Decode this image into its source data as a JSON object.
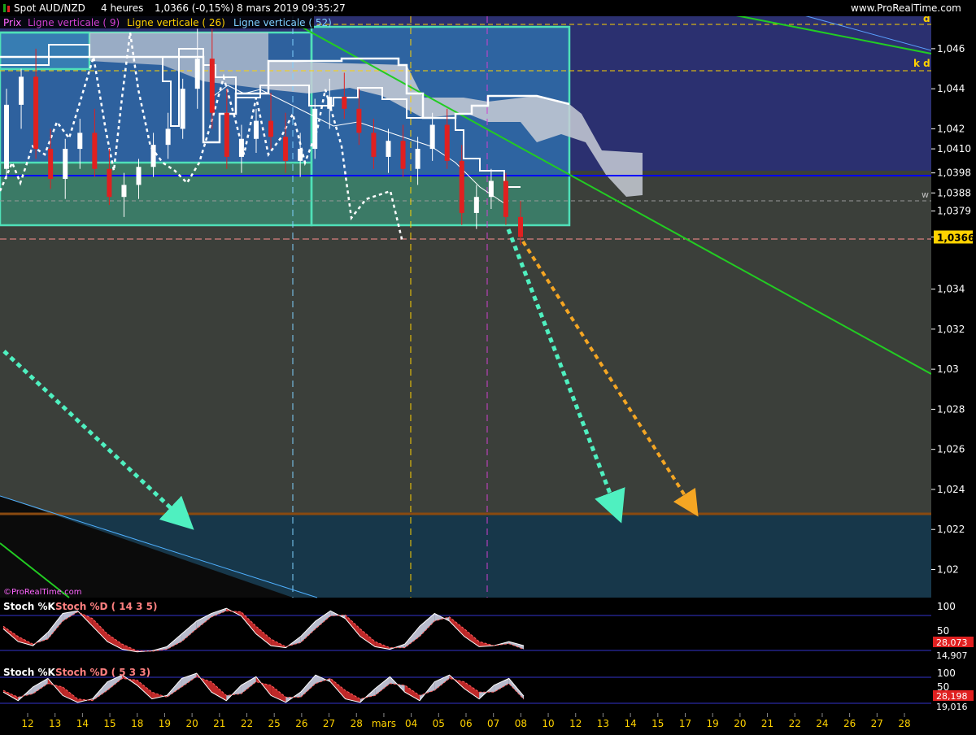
{
  "header": {
    "instrument": "Spot AUD/NZD",
    "timeframe": "4 heures",
    "last_change": "1,0366 (-0,15%)",
    "datetime": "8 mars 2019 09:35:27",
    "brand": "www.ProRealTime.com",
    "watermark": "©ProRealTime.com"
  },
  "legend": {
    "price": "Prix",
    "vline9": "Ligne verticale ( 9)",
    "vline26": "Ligne verticale ( 26)",
    "vline52": "Ligne verticale ( 52)"
  },
  "colors": {
    "background": "#3b3f3a",
    "upper_zone": "#2b3070",
    "lower_zone": "#17374a",
    "blue_box": "#2f6aa6",
    "green_box": "#3b7a66",
    "box_border": "#4fe0b8",
    "trendline": "#22cc22",
    "support": "#8a4a10",
    "blue_hline": "#0000ff",
    "up_candle": "#ffffff",
    "down_candle": "#e02020",
    "arrow_teal": "#4ff0c0",
    "arrow_orange": "#f5a623",
    "price_tag": "#ffd200"
  },
  "chart_data": [
    {
      "type": "candlestick",
      "price_axis_ticks": [
        "1,046",
        "1,044",
        "1,042",
        "1,0410",
        "1,0398",
        "1,0388",
        "1,0379",
        "1,0366",
        "1,034",
        "1,032",
        "1,03",
        "1,028",
        "1,026",
        "1,024",
        "1,022",
        "1,02"
      ],
      "ylim": [
        1.0186,
        1.0477
      ],
      "last_price": "1,0366",
      "x_ticks": [
        "12",
        "13",
        "14",
        "15",
        "18",
        "19",
        "20",
        "21",
        "22",
        "25",
        "26",
        "27",
        "28",
        "mars",
        "04",
        "05",
        "06",
        "07",
        "08",
        "10",
        "12",
        "13",
        "14",
        "15",
        "17",
        "19",
        "20",
        "21",
        "22",
        "24",
        "26",
        "27",
        "28"
      ],
      "ohlc": [
        [
          1.04,
          1.044,
          1.0395,
          1.0432
        ],
        [
          1.0432,
          1.045,
          1.042,
          1.0446
        ],
        [
          1.0446,
          1.046,
          1.0405,
          1.041
        ],
        [
          1.041,
          1.042,
          1.039,
          1.0395
        ],
        [
          1.0395,
          1.0415,
          1.0385,
          1.041
        ],
        [
          1.041,
          1.0425,
          1.04,
          1.0418
        ],
        [
          1.0418,
          1.043,
          1.0396,
          1.04
        ],
        [
          1.04,
          1.041,
          1.0382,
          1.0386
        ],
        [
          1.0386,
          1.0398,
          1.0376,
          1.0392
        ],
        [
          1.0392,
          1.0405,
          1.0385,
          1.0401
        ],
        [
          1.0401,
          1.0418,
          1.0396,
          1.0412
        ],
        [
          1.0412,
          1.0428,
          1.0405,
          1.042
        ],
        [
          1.042,
          1.0445,
          1.0415,
          1.044
        ],
        [
          1.044,
          1.047,
          1.043,
          1.0455
        ],
        [
          1.0455,
          1.047,
          1.042,
          1.0428
        ],
        [
          1.0428,
          1.044,
          1.04,
          1.0406
        ],
        [
          1.0406,
          1.0422,
          1.0398,
          1.0415
        ],
        [
          1.0415,
          1.043,
          1.0408,
          1.0424
        ],
        [
          1.0424,
          1.0438,
          1.041,
          1.0416
        ],
        [
          1.0416,
          1.0428,
          1.0398,
          1.0404
        ],
        [
          1.0404,
          1.0418,
          1.0396,
          1.041
        ],
        [
          1.041,
          1.0435,
          1.0405,
          1.043
        ],
        [
          1.043,
          1.0445,
          1.042,
          1.0436
        ],
        [
          1.0436,
          1.0448,
          1.0425,
          1.043
        ],
        [
          1.043,
          1.044,
          1.0412,
          1.0418
        ],
        [
          1.0418,
          1.0425,
          1.04,
          1.0406
        ],
        [
          1.0406,
          1.042,
          1.0398,
          1.0414
        ],
        [
          1.0414,
          1.0422,
          1.0396,
          1.04
        ],
        [
          1.04,
          1.0416,
          1.0392,
          1.041
        ],
        [
          1.041,
          1.0428,
          1.0404,
          1.0422
        ],
        [
          1.0422,
          1.043,
          1.04,
          1.0404
        ],
        [
          1.0404,
          1.0412,
          1.0372,
          1.0378
        ],
        [
          1.0378,
          1.0392,
          1.037,
          1.0386
        ],
        [
          1.0386,
          1.04,
          1.038,
          1.0394
        ],
        [
          1.0394,
          1.0398,
          1.0372,
          1.0376
        ],
        [
          1.0376,
          1.0384,
          1.0362,
          1.0366
        ]
      ]
    },
    {
      "type": "line",
      "name": "Stoch %K / Stoch %D ( 14 3 5)",
      "ylim": [
        0,
        100
      ],
      "ticks": [
        "100",
        "50"
      ],
      "k_value": "28,073",
      "d_value": "14,907",
      "k": [
        55,
        30,
        22,
        48,
        85,
        90,
        60,
        30,
        15,
        10,
        12,
        20,
        45,
        70,
        85,
        95,
        80,
        45,
        22,
        18,
        40,
        70,
        90,
        75,
        40,
        20,
        15,
        25,
        60,
        85,
        70,
        40,
        20,
        22,
        30,
        22
      ],
      "d": [
        60,
        40,
        25,
        35,
        70,
        88,
        75,
        45,
        25,
        12,
        11,
        15,
        30,
        55,
        78,
        90,
        88,
        60,
        35,
        20,
        28,
        55,
        80,
        82,
        55,
        30,
        18,
        18,
        40,
        70,
        78,
        55,
        30,
        22,
        26,
        15
      ]
    },
    {
      "type": "line",
      "name": "Stoch %K / Stoch %D ( 5 3 3)",
      "ylim": [
        0,
        100
      ],
      "ticks": [
        "100",
        "50"
      ],
      "k_value": "28,198",
      "d_value": "19,016",
      "k": [
        40,
        15,
        55,
        80,
        30,
        10,
        20,
        70,
        90,
        60,
        20,
        30,
        80,
        95,
        40,
        15,
        60,
        85,
        30,
        10,
        40,
        90,
        70,
        20,
        10,
        50,
        85,
        40,
        15,
        70,
        90,
        50,
        20,
        60,
        80,
        28
      ],
      "d": [
        45,
        25,
        35,
        65,
        55,
        20,
        15,
        45,
        80,
        75,
        40,
        25,
        55,
        85,
        70,
        30,
        35,
        70,
        60,
        25,
        25,
        65,
        80,
        45,
        20,
        30,
        65,
        60,
        30,
        45,
        80,
        70,
        40,
        40,
        65,
        19
      ]
    }
  ]
}
